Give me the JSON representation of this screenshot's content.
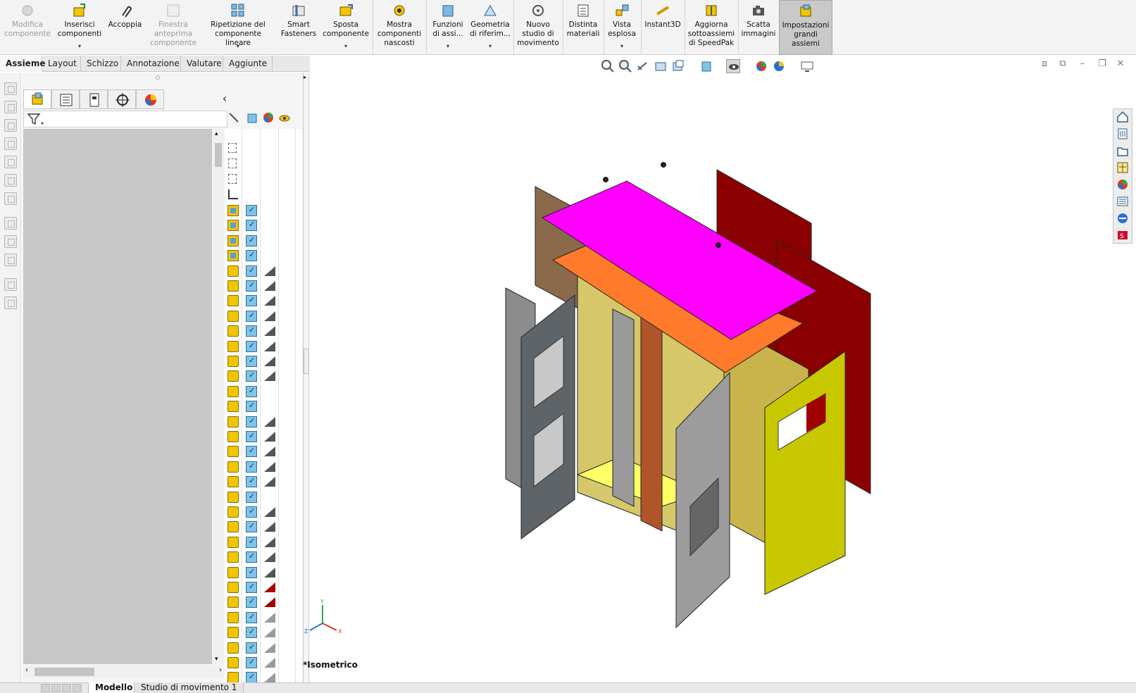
{
  "ribbon": {
    "buttons": [
      {
        "label": "Modifica\ncomponente",
        "disabled": true
      },
      {
        "label": "Inserisci\ncomponenti",
        "disabled": false
      },
      {
        "label": "Accoppia",
        "disabled": false
      },
      {
        "label": "Finestra\nanteprima\ncomponente",
        "disabled": true
      },
      {
        "label": "Ripetizione del\ncomponente lineare",
        "disabled": false
      },
      {
        "label": "Smart\nFasteners",
        "disabled": false
      },
      {
        "label": "Sposta\ncomponente",
        "disabled": false
      },
      {
        "label": "Mostra\ncomponenti\nnascosti",
        "disabled": false
      },
      {
        "label": "Funzioni\ndi assi...",
        "disabled": false
      },
      {
        "label": "Geometria\ndi riferim...",
        "disabled": false
      },
      {
        "label": "Nuovo\nstudio di\nmovimento",
        "disabled": false
      },
      {
        "label": "Distinta\nmateriali",
        "disabled": false
      },
      {
        "label": "Vista\nesplosa",
        "disabled": false
      },
      {
        "label": "Instant3D",
        "disabled": false
      },
      {
        "label": "Aggiorna\nsottoassiemi\ndi SpeedPak",
        "disabled": false
      },
      {
        "label": "Scatta\nimmagini",
        "disabled": false
      },
      {
        "label": "Impostazioni\ngrandi\nassiemi",
        "disabled": false
      }
    ]
  },
  "command_tabs": [
    "Assieme",
    "Layout",
    "Schizzo",
    "Annotazione",
    "Valutare",
    "Aggiunte"
  ],
  "viewport": {
    "view_label": "*Isometrico",
    "triad": {
      "y": "Y",
      "x": "X",
      "z": "Z"
    }
  },
  "bottom_tabs": [
    "Modello",
    "Studio di movimento 1"
  ],
  "colors": {
    "top_panel": "#ff00ff",
    "back_panel": "#8b0000",
    "door_panel": "#c8c800",
    "body": "#c8b44a",
    "frame": "#ff7a2a",
    "door_grey": "#8c8c8c"
  }
}
